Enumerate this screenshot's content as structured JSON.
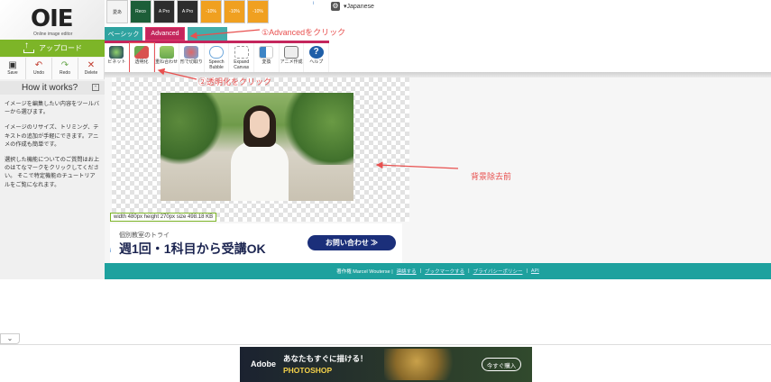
{
  "app": {
    "logo_text": "OIE",
    "logo_subtitle": "Online image editor",
    "upload_label": "アップロード"
  },
  "edit_tools": [
    {
      "label": "Save",
      "icon": "save-icon"
    },
    {
      "label": "Undo",
      "icon": "undo-icon"
    },
    {
      "label": "Redo",
      "icon": "redo-icon"
    },
    {
      "label": "Delete",
      "icon": "delete-icon"
    }
  ],
  "help": {
    "title": "How it works?",
    "toggle": "-",
    "paragraphs": [
      "イメージを編集したい内容をツールバーから選びます。",
      "イメージのリサイズ、トリミング、テキストの追加が手軽にできます。アニメの作成も簡単です。",
      "選択した機能についてのご質問はお上のはてなマークをクリックしてください。 そこで特定機能のチュートリアルをご覧になれます。"
    ]
  },
  "thumbnails": [
    "愛あ",
    "Reco",
    "A Pro",
    "A Pro",
    "-10%",
    "-10%",
    "-10%"
  ],
  "ad_marker": "i",
  "language": {
    "label": "▾Japanese"
  },
  "tabs": [
    {
      "label": "ベーシック",
      "active": false
    },
    {
      "label": "Advanced",
      "active": true
    },
    {
      "label": "",
      "active": false
    }
  ],
  "tools": [
    {
      "label": "ビネット",
      "icon": "vignette-icon",
      "color": "#2a5f9e"
    },
    {
      "label": "透明化",
      "icon": "transparency-icon",
      "color": "#d9534f"
    },
    {
      "label": "重ね合わせ",
      "icon": "layers-icon",
      "color": "#6aa84f"
    },
    {
      "label": "形で切取り",
      "icon": "heart-shape-icon",
      "color": "#e06666"
    },
    {
      "label": "Speech Bubble",
      "icon": "speech-bubble-icon",
      "color": "#6fa8dc"
    },
    {
      "label": "Expand Canvas",
      "icon": "expand-canvas-icon",
      "color": "#999999"
    },
    {
      "label": "変換",
      "icon": "convert-icon",
      "color": "#3d85c6"
    },
    {
      "label": "アニメ作成",
      "icon": "animation-icon",
      "color": "#777777"
    },
    {
      "label": "ヘルプ",
      "icon": "help-icon",
      "color": "#1f5fa8"
    }
  ],
  "image_info": "width 480px  height 270px  size 498.18 KB",
  "ad_banner": {
    "small": "個別教室のトライ",
    "big": "週1回・1科目から受講OK",
    "button": "お問い合わせ ≫",
    "info": "i"
  },
  "footer": {
    "copyright": "著作権 Marcel Wouterse |",
    "links": [
      "連絡する",
      "ブックマークする",
      "プライバシーポリシー",
      "API"
    ]
  },
  "annotations": {
    "step1": "①Advancedをクリック",
    "step2": "②透明化をクリック",
    "step3": "背景除去前"
  },
  "collapse": "⌄",
  "bottom_ad": {
    "brand": "Adobe",
    "headline": "あなたもすぐに描ける！",
    "product": "PHOTOSHOP",
    "cta": "今すぐ購入"
  },
  "colors": {
    "accent_teal": "#2fa3a0",
    "accent_magenta": "#c4265c",
    "upload_green": "#7db528",
    "annotation_red": "#e8504f"
  }
}
